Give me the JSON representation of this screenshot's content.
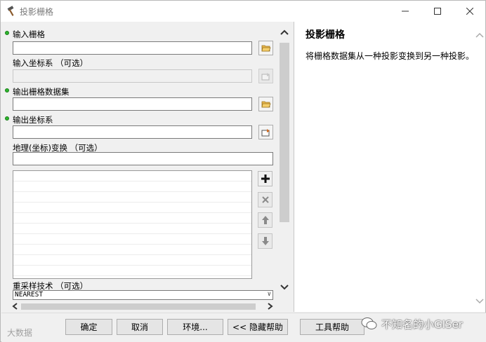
{
  "window": {
    "title": "投影栅格"
  },
  "form": {
    "input_raster_label": "输入栅格",
    "input_cs_label": "输入坐标系 （可选）",
    "output_dataset_label": "输出栅格数据集",
    "output_cs_label": "输出坐标系",
    "geo_transform_label": "地理(坐标)变换 （可选）",
    "resampling_label": "重采样技术 （可选）",
    "resampling_value": "NEAREST"
  },
  "help": {
    "title": "投影栅格",
    "description": "将栅格数据集从一种投影变换到另一种投影。"
  },
  "buttons": {
    "ok": "确定",
    "cancel": "取消",
    "environments": "环境...",
    "hide_help": "<< 隐藏帮助",
    "tool_help": "工具帮助"
  },
  "watermarks": {
    "left": "大数据",
    "right": "不知名的小GISer"
  },
  "colors": {
    "required_dot": "#2db52d",
    "background": "#f0f0f0"
  }
}
